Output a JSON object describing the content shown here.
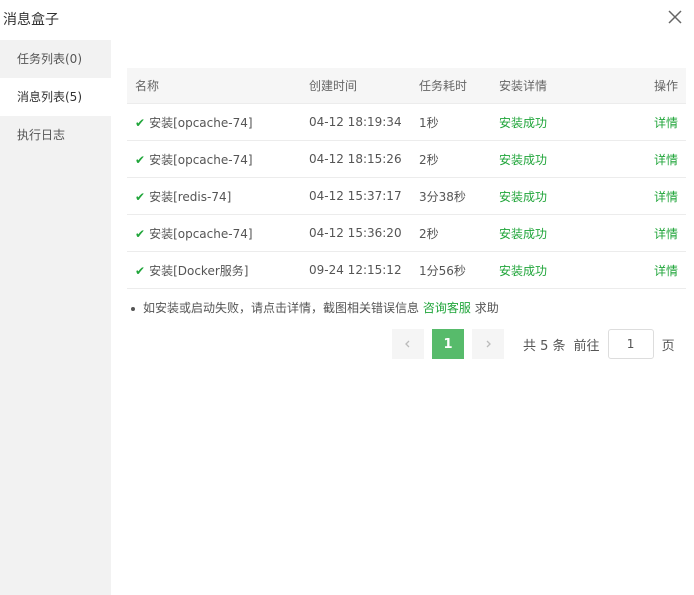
{
  "dialog": {
    "title": "消息盒子"
  },
  "sidebar": {
    "items": [
      {
        "label": "任务列表(0)"
      },
      {
        "label": "消息列表(5)"
      },
      {
        "label": "执行日志"
      }
    ]
  },
  "table": {
    "headers": {
      "name": "名称",
      "created": "创建时间",
      "duration": "任务耗时",
      "detail": "安装详情",
      "action": "操作"
    },
    "rows": [
      {
        "name": "安装[opcache-74]",
        "created": "04-12 18:19:34",
        "duration": "1秒",
        "status": "安装成功",
        "action": "详情"
      },
      {
        "name": "安装[opcache-74]",
        "created": "04-12 18:15:26",
        "duration": "2秒",
        "status": "安装成功",
        "action": "详情"
      },
      {
        "name": "安装[redis-74]",
        "created": "04-12 15:37:17",
        "duration": "3分38秒",
        "status": "安装成功",
        "action": "详情"
      },
      {
        "name": "安装[opcache-74]",
        "created": "04-12 15:36:20",
        "duration": "2秒",
        "status": "安装成功",
        "action": "详情"
      },
      {
        "name": "安装[Docker服务]",
        "created": "09-24 12:15:12",
        "duration": "1分56秒",
        "status": "安装成功",
        "action": "详情"
      }
    ]
  },
  "note": {
    "text": "如安装或启动失败，请点击详情，截图相关错误信息",
    "link": "咨询客服",
    "suffix": "求助"
  },
  "pagination": {
    "current": "1",
    "total": "共 5 条",
    "goto": "前往",
    "page_input": "1",
    "page_unit": "页"
  },
  "colors": {
    "accent": "#20a53a",
    "sidebar_bg": "#f2f2f2"
  }
}
